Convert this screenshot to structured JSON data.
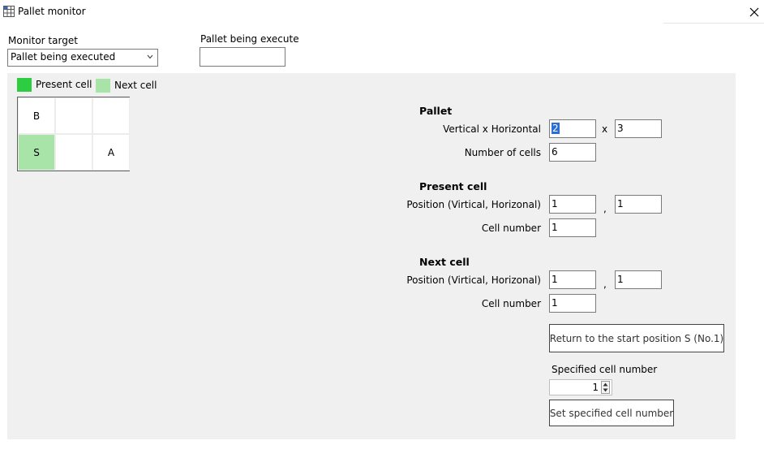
{
  "window": {
    "title": "Pallet monitor",
    "close_icon": "close-icon"
  },
  "monitor_target": {
    "label": "Monitor target",
    "selected": "Pallet being executed"
  },
  "pallet_being_execute": {
    "label": "Pallet being execute",
    "value": ""
  },
  "legend": {
    "present_cell": {
      "label": "Present cell",
      "color": "#2ecc40"
    },
    "next_cell": {
      "label": "Next cell",
      "color": "#a8e3a8"
    }
  },
  "grid": {
    "rows": [
      [
        "B",
        "",
        ""
      ],
      [
        "S",
        "",
        "A"
      ]
    ],
    "highlight_color": "#a8e3a8"
  },
  "pallet": {
    "heading": "Pallet",
    "vh_label": "Vertical x Horizontal",
    "vertical": "2",
    "times": "x",
    "horizontal": "3",
    "cells_label": "Number of cells",
    "cells": "6"
  },
  "present_cell": {
    "heading": "Present cell",
    "position_label": "Position (Virtical, Horizonal)",
    "vertical": "1",
    "comma": ",",
    "horizontal": "1",
    "number_label": "Cell number",
    "number": "1"
  },
  "next_cell": {
    "heading": "Next cell",
    "position_label": "Position (Virtical, Horizonal)",
    "vertical": "1",
    "comma": ",",
    "horizontal": "1",
    "number_label": "Cell number",
    "number": "1"
  },
  "return_button": {
    "label": "Return to the start position S (No.1)"
  },
  "specified": {
    "label": "Specified cell number",
    "value": "1"
  },
  "set_button": {
    "label": "Set specified cell number"
  }
}
